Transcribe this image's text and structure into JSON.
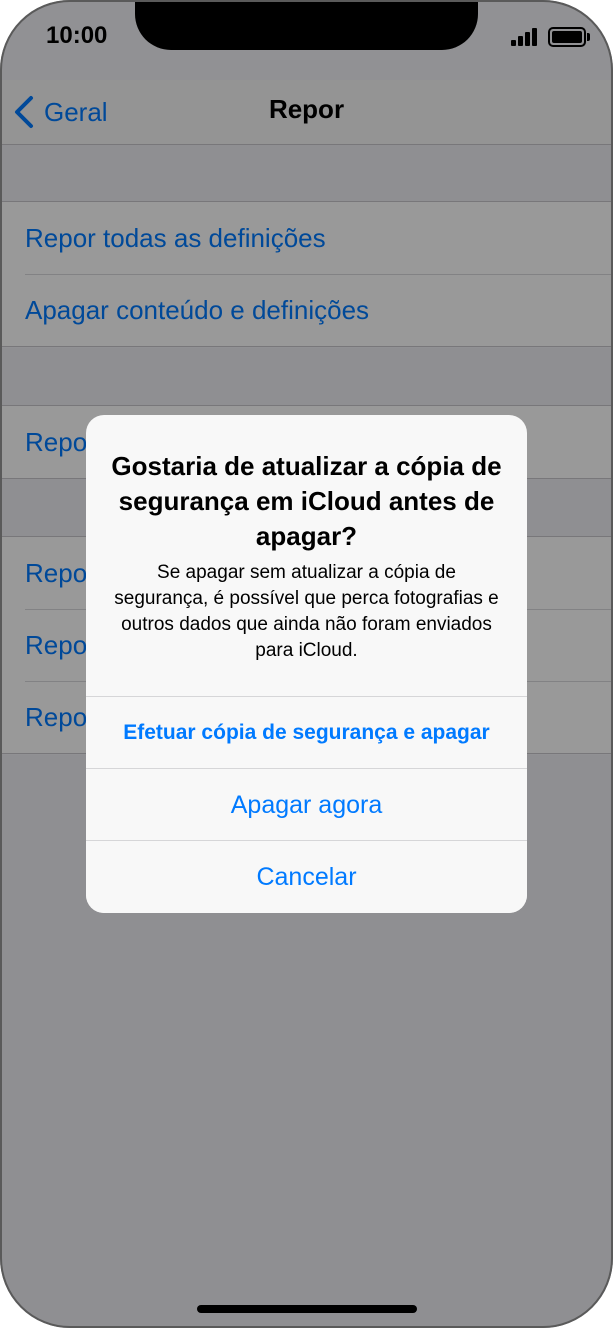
{
  "status_bar": {
    "time": "10:00"
  },
  "nav": {
    "back_label": "Geral",
    "title": "Repor"
  },
  "groups": [
    {
      "items": [
        "Repor todas as definições",
        "Apagar conteúdo e definições"
      ]
    },
    {
      "items": [
        "Repor"
      ]
    },
    {
      "items": [
        "Repor",
        "Repor",
        "Repor"
      ]
    }
  ],
  "alert": {
    "title": "Gostaria de atualizar a cópia de segurança em iCloud antes de apagar?",
    "message": "Se apagar sem atualizar a cópia de segurança, é possível que perca fotografias e outros dados que ainda não foram enviados para iCloud.",
    "buttons": {
      "backup_and_erase": "Efetuar cópia de segurança e apagar",
      "erase_now": "Apagar agora",
      "cancel": "Cancelar"
    }
  },
  "colors": {
    "accent": "#007aff",
    "background": "#efeff4",
    "dim_overlay": "rgba(0,0,0,0.40)"
  },
  "icons": {
    "back": "chevron-left-icon",
    "signal": "cellular-signal-icon",
    "battery": "battery-icon"
  }
}
